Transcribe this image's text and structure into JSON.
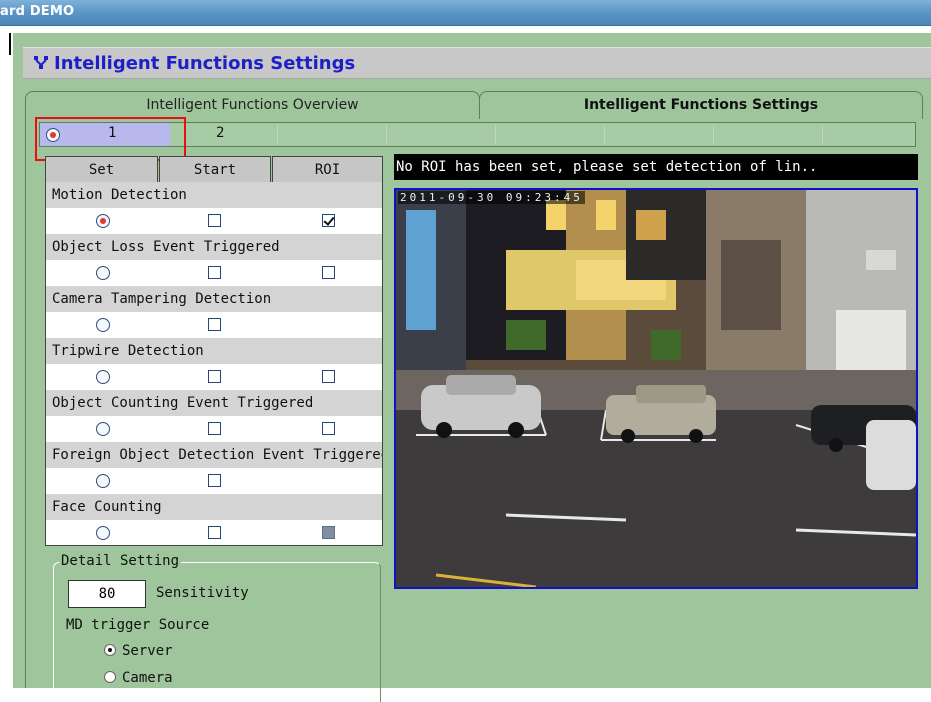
{
  "window": {
    "title": "ard DEMO"
  },
  "page": {
    "heading": "Intelligent Functions Settings",
    "heading_icon": "settings-tree-icon"
  },
  "tabs": [
    {
      "label": "Intelligent Functions Overview",
      "active": false
    },
    {
      "label": "Intelligent Functions Settings",
      "active": true
    }
  ],
  "channels": [
    {
      "label": "1",
      "selected": true
    },
    {
      "label": "2",
      "selected": false
    }
  ],
  "grid": {
    "headers": [
      "Set",
      "Start",
      "ROI"
    ],
    "rows": [
      {
        "label": "Motion Detection",
        "set": true,
        "start": false,
        "roi": "checked"
      },
      {
        "label": "Object Loss Event Triggered",
        "set": false,
        "start": false,
        "roi": "unchecked"
      },
      {
        "label": "Camera Tampering Detection",
        "set": false,
        "start": false,
        "roi": "none"
      },
      {
        "label": "Tripwire Detection",
        "set": false,
        "start": false,
        "roi": "unchecked"
      },
      {
        "label": "Object Counting Event Triggered",
        "set": false,
        "start": false,
        "roi": "unchecked"
      },
      {
        "label": "Foreign Object Detection Event Triggered",
        "set": false,
        "start": false,
        "roi": "none"
      },
      {
        "label": "Face Counting",
        "set": false,
        "start": false,
        "roi": "disabled"
      }
    ]
  },
  "detail": {
    "legend": "Detail Setting",
    "sensitivity_value": "80",
    "sensitivity_label": "Sensitivity",
    "md_trigger_label": "MD trigger Source",
    "options": [
      {
        "label": "Server",
        "selected": true
      },
      {
        "label": "Camera",
        "selected": false
      }
    ]
  },
  "video": {
    "message": "No ROI has been set, please set detection of lin..",
    "timestamp": "2011-09-30 09:23:45"
  },
  "colors": {
    "accent": "#1f1fc8",
    "panel": "#9ec59b",
    "highlight": "#e81010",
    "video_border": "#1010c8"
  }
}
